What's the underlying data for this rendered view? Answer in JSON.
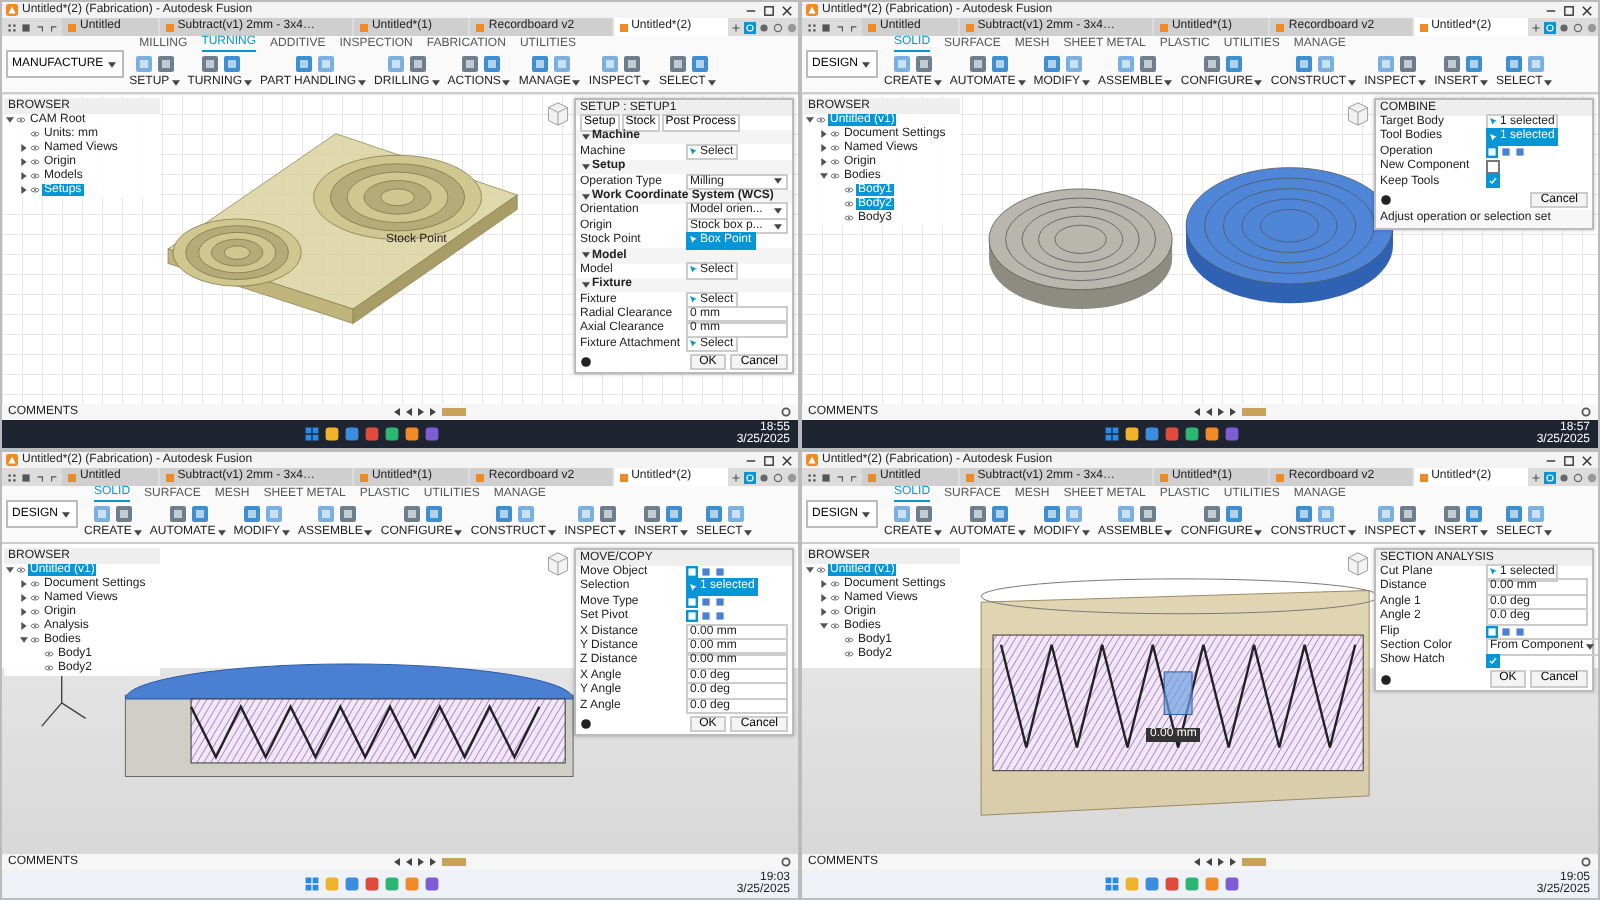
{
  "panels": [
    {
      "title": "Untitled*(2) (Fabrication) - Autodesk Fusion",
      "doc_tabs": [
        {
          "label": "Untitled",
          "selected": false
        },
        {
          "label": "Subtract(v1) 2mm - 3x4…",
          "selected": false
        },
        {
          "label": "Untitled*(1)",
          "selected": false
        },
        {
          "label": "Recordboard v2",
          "selected": false
        },
        {
          "label": "Untitled*(2)",
          "selected": true
        }
      ],
      "workspace": "MANUFACTURE",
      "ribbon_tabs": [
        {
          "label": "MILLING",
          "selected": false
        },
        {
          "label": "TURNING",
          "selected": true
        },
        {
          "label": "ADDITIVE",
          "selected": false
        },
        {
          "label": "INSPECTION",
          "selected": false
        },
        {
          "label": "FABRICATION",
          "selected": false
        },
        {
          "label": "UTILITIES",
          "selected": false
        }
      ],
      "tool_groups": [
        "SETUP",
        "TURNING",
        "PART HANDLING",
        "DRILLING",
        "ACTIONS",
        "MANAGE",
        "INSPECT",
        "SELECT"
      ],
      "browser": {
        "title": "BROWSER",
        "items": [
          {
            "label": "CAM Root",
            "selected": false,
            "expanded": true,
            "children": [
              {
                "label": "Units: mm",
                "selected": false
              },
              {
                "label": "Named Views",
                "selected": false,
                "expanded": false
              },
              {
                "label": "Origin",
                "selected": false,
                "expanded": false
              },
              {
                "label": "Models",
                "selected": false,
                "expanded": false
              },
              {
                "label": "Setups",
                "selected": true,
                "expanded": false
              }
            ]
          }
        ]
      },
      "dialog": {
        "title": "SETUP : SETUP1",
        "rows": [
          {
            "kind": "tabs",
            "items": [
              "Setup",
              "Stock",
              "Post Process"
            ]
          },
          {
            "kind": "section",
            "label": "Machine"
          },
          {
            "kind": "selection",
            "label": "Machine",
            "value": "Select",
            "active": false
          },
          {
            "kind": "section",
            "label": "Setup"
          },
          {
            "kind": "dropdown",
            "label": "Operation Type",
            "value": "Milling"
          },
          {
            "kind": "section",
            "label": "Work Coordinate System (WCS)"
          },
          {
            "kind": "dropdown",
            "label": "Orientation",
            "value": "Model orien..."
          },
          {
            "kind": "dropdown",
            "label": "Origin",
            "value": "Stock box p..."
          },
          {
            "kind": "selection",
            "label": "Stock Point",
            "value": "Box Point",
            "active": true
          },
          {
            "kind": "section",
            "label": "Model"
          },
          {
            "kind": "selection",
            "label": "Model",
            "value": "Select",
            "active": false
          },
          {
            "kind": "section",
            "label": "Fixture"
          },
          {
            "kind": "selection",
            "label": "Fixture",
            "value": "Select",
            "active": false
          },
          {
            "kind": "input",
            "label": "Radial Clearance",
            "value": "0 mm"
          },
          {
            "kind": "input",
            "label": "Axial Clearance",
            "value": "0 mm"
          },
          {
            "kind": "selection",
            "label": "Fixture Attachment",
            "value": "Select",
            "active": false
          }
        ],
        "buttons": [
          "OK",
          "Cancel"
        ]
      },
      "scene": {
        "kind": "molds",
        "label": "Stock Point"
      },
      "comments": "COMMENTS",
      "taskbar": {
        "dark": true,
        "time": "18:55",
        "date": "3/25/2025"
      }
    },
    {
      "title": "Untitled*(2) (Fabrication) - Autodesk Fusion",
      "doc_tabs": [
        {
          "label": "Untitled",
          "selected": false
        },
        {
          "label": "Subtract(v1) 2mm - 3x4…",
          "selected": false
        },
        {
          "label": "Untitled*(1)",
          "selected": false
        },
        {
          "label": "Recordboard v2",
          "selected": false
        },
        {
          "label": "Untitled*(2)",
          "selected": true
        }
      ],
      "workspace": "DESIGN",
      "ribbon_tabs": [
        {
          "label": "SOLID",
          "selected": true
        },
        {
          "label": "SURFACE",
          "selected": false
        },
        {
          "label": "MESH",
          "selected": false
        },
        {
          "label": "SHEET METAL",
          "selected": false
        },
        {
          "label": "PLASTIC",
          "selected": false
        },
        {
          "label": "UTILITIES",
          "selected": false
        },
        {
          "label": "MANAGE",
          "selected": false
        }
      ],
      "tool_groups": [
        "CREATE",
        "AUTOMATE",
        "MODIFY",
        "ASSEMBLE",
        "CONFIGURE",
        "CONSTRUCT",
        "INSPECT",
        "INSERT",
        "SELECT"
      ],
      "browser": {
        "title": "BROWSER",
        "items": [
          {
            "label": "Untitled (v1)",
            "selected": true,
            "expanded": true,
            "children": [
              {
                "label": "Document Settings",
                "selected": false,
                "expanded": false
              },
              {
                "label": "Named Views",
                "selected": false,
                "expanded": false
              },
              {
                "label": "Origin",
                "selected": false,
                "expanded": false
              },
              {
                "label": "Bodies",
                "selected": false,
                "expanded": true,
                "children": [
                  {
                    "label": "Body1",
                    "selected": true
                  },
                  {
                    "label": "Body2",
                    "selected": true
                  },
                  {
                    "label": "Body3",
                    "selected": false
                  }
                ]
              }
            ]
          }
        ]
      },
      "dialog": {
        "title": "COMBINE",
        "rows": [
          {
            "kind": "selection",
            "label": "Target Body",
            "value": "1 selected",
            "active": false
          },
          {
            "kind": "selection",
            "label": "Tool Bodies",
            "value": "1 selected",
            "active": true
          },
          {
            "kind": "icons",
            "label": "Operation"
          },
          {
            "kind": "check",
            "label": "New Component",
            "checked": false
          },
          {
            "kind": "check",
            "label": "Keep Tools",
            "checked": true
          }
        ],
        "hint": "Adjust operation or selection set",
        "buttons": [
          "Cancel"
        ]
      },
      "scene": {
        "kind": "discs"
      },
      "comments": "COMMENTS",
      "taskbar": {
        "dark": true,
        "time": "18:57",
        "date": "3/25/2025"
      }
    },
    {
      "title": "Untitled*(2) (Fabrication) - Autodesk Fusion",
      "doc_tabs": [
        {
          "label": "Untitled",
          "selected": false
        },
        {
          "label": "Subtract(v1) 2mm - 3x4…",
          "selected": false
        },
        {
          "label": "Untitled*(1)",
          "selected": false
        },
        {
          "label": "Recordboard v2",
          "selected": false
        },
        {
          "label": "Untitled*(2)",
          "selected": true
        }
      ],
      "workspace": "DESIGN",
      "ribbon_tabs": [
        {
          "label": "SOLID",
          "selected": true
        },
        {
          "label": "SURFACE",
          "selected": false
        },
        {
          "label": "MESH",
          "selected": false
        },
        {
          "label": "SHEET METAL",
          "selected": false
        },
        {
          "label": "PLASTIC",
          "selected": false
        },
        {
          "label": "UTILITIES",
          "selected": false
        },
        {
          "label": "MANAGE",
          "selected": false
        }
      ],
      "tool_groups": [
        "CREATE",
        "AUTOMATE",
        "MODIFY",
        "ASSEMBLE",
        "CONFIGURE",
        "CONSTRUCT",
        "INSPECT",
        "INSERT",
        "SELECT"
      ],
      "browser": {
        "title": "BROWSER",
        "items": [
          {
            "label": "Untitled (v1)",
            "selected": true,
            "expanded": true,
            "children": [
              {
                "label": "Document Settings",
                "selected": false,
                "expanded": false
              },
              {
                "label": "Named Views",
                "selected": false,
                "expanded": false
              },
              {
                "label": "Origin",
                "selected": false,
                "expanded": false
              },
              {
                "label": "Analysis",
                "selected": false,
                "expanded": false
              },
              {
                "label": "Bodies",
                "selected": false,
                "expanded": true,
                "children": [
                  {
                    "label": "Body1",
                    "selected": false
                  },
                  {
                    "label": "Body2",
                    "selected": false
                  }
                ]
              }
            ]
          }
        ]
      },
      "dialog": {
        "title": "MOVE/COPY",
        "rows": [
          {
            "kind": "icons",
            "label": "Move Object"
          },
          {
            "kind": "selection",
            "label": "Selection",
            "value": "1 selected",
            "active": true
          },
          {
            "kind": "icons",
            "label": "Move Type"
          },
          {
            "kind": "icons",
            "label": "Set Pivot"
          },
          {
            "kind": "input",
            "label": "X Distance",
            "value": "0.00 mm"
          },
          {
            "kind": "input",
            "label": "Y Distance",
            "value": "0.00 mm"
          },
          {
            "kind": "input",
            "label": "Z Distance",
            "value": "0.00 mm"
          },
          {
            "kind": "input",
            "label": "X Angle",
            "value": "0.0 deg"
          },
          {
            "kind": "input",
            "label": "Y Angle",
            "value": "0.0 deg"
          },
          {
            "kind": "input",
            "label": "Z Angle",
            "value": "0.0 deg"
          }
        ],
        "buttons": [
          "OK",
          "Cancel"
        ]
      },
      "scene": {
        "kind": "section-cap"
      },
      "comments": "COMMENTS",
      "taskbar": {
        "dark": false,
        "time": "19:03",
        "date": "3/25/2025"
      }
    },
    {
      "title": "Untitled*(2) (Fabrication) - Autodesk Fusion",
      "doc_tabs": [
        {
          "label": "Untitled",
          "selected": false
        },
        {
          "label": "Subtract(v1) 2mm - 3x4…",
          "selected": false
        },
        {
          "label": "Untitled*(1)",
          "selected": false
        },
        {
          "label": "Recordboard v2",
          "selected": false
        },
        {
          "label": "Untitled*(2)",
          "selected": true
        }
      ],
      "workspace": "DESIGN",
      "ribbon_tabs": [
        {
          "label": "SOLID",
          "selected": true
        },
        {
          "label": "SURFACE",
          "selected": false
        },
        {
          "label": "MESH",
          "selected": false
        },
        {
          "label": "SHEET METAL",
          "selected": false
        },
        {
          "label": "PLASTIC",
          "selected": false
        },
        {
          "label": "UTILITIES",
          "selected": false
        },
        {
          "label": "MANAGE",
          "selected": false
        }
      ],
      "tool_groups": [
        "CREATE",
        "AUTOMATE",
        "MODIFY",
        "ASSEMBLE",
        "CONFIGURE",
        "CONSTRUCT",
        "INSPECT",
        "INSERT",
        "SELECT"
      ],
      "browser": {
        "title": "BROWSER",
        "items": [
          {
            "label": "Untitled (v1)",
            "selected": true,
            "expanded": true,
            "children": [
              {
                "label": "Document Settings",
                "selected": false,
                "expanded": false
              },
              {
                "label": "Named Views",
                "selected": false,
                "expanded": false
              },
              {
                "label": "Origin",
                "selected": false,
                "expanded": false
              },
              {
                "label": "Bodies",
                "selected": false,
                "expanded": true,
                "children": [
                  {
                    "label": "Body1",
                    "selected": false
                  },
                  {
                    "label": "Body2",
                    "selected": false
                  }
                ]
              }
            ]
          }
        ]
      },
      "dialog": {
        "title": "SECTION ANALYSIS",
        "rows": [
          {
            "kind": "selection",
            "label": "Cut Plane",
            "value": "1 selected",
            "active": false
          },
          {
            "kind": "input",
            "label": "Distance",
            "value": "0.00 mm"
          },
          {
            "kind": "input",
            "label": "Angle 1",
            "value": "0.0 deg"
          },
          {
            "kind": "input",
            "label": "Angle 2",
            "value": "0.0 deg"
          },
          {
            "kind": "icons",
            "label": "Flip"
          },
          {
            "kind": "dropdown",
            "label": "Section Color",
            "value": "From Component"
          },
          {
            "kind": "check",
            "label": "Show Hatch",
            "checked": true
          }
        ],
        "buttons": [
          "OK",
          "Cancel"
        ]
      },
      "scene": {
        "kind": "section-plane",
        "label": "0.00 mm"
      },
      "comments": "COMMENTS",
      "taskbar": {
        "dark": false,
        "time": "19:05",
        "date": "3/25/2025"
      }
    }
  ]
}
